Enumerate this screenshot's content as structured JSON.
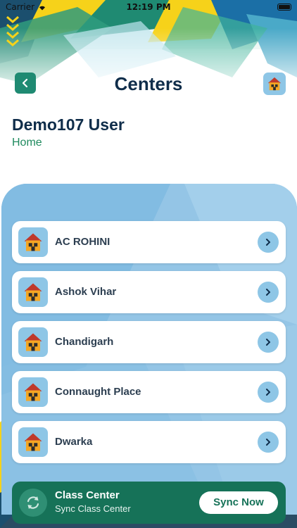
{
  "status_bar": {
    "carrier": "Carrier",
    "time": "12:19 PM"
  },
  "header": {
    "title": "Centers",
    "user_name": "Demo107 User",
    "breadcrumb": "Home"
  },
  "centers": [
    {
      "label": "AC ROHINI"
    },
    {
      "label": "Ashok Vihar"
    },
    {
      "label": "Chandigarh"
    },
    {
      "label": "Connaught Place"
    },
    {
      "label": "Dwarka"
    }
  ],
  "sync": {
    "title": "Class Center",
    "subtitle": "Sync Class Center",
    "button_label": "Sync Now"
  },
  "icons": {
    "back": "chevron-left-icon",
    "home": "house-icon",
    "row_chevron": "chevron-right-icon",
    "sync": "sync-icon"
  },
  "colors": {
    "primary_green": "#167258",
    "navy": "#0f2d4a",
    "light_blue": "#8ec6e6",
    "accent_yellow": "#f6d21a"
  }
}
